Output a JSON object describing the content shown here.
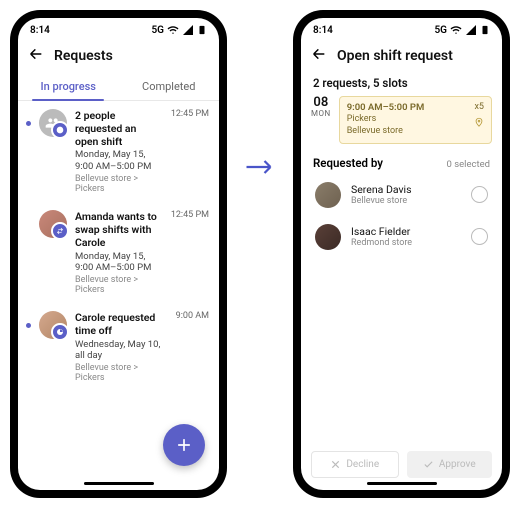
{
  "status": {
    "time": "8:14",
    "network": "5G"
  },
  "left": {
    "title": "Requests",
    "tabs": {
      "inprogress": "In progress",
      "completed": "Completed"
    },
    "items": [
      {
        "title": "2 people requested an open shift",
        "sub": "Monday, May 15, 9:00 AM–5:00 PM",
        "breadcrumb": "Bellevue store > Pickers",
        "time": "12:45 PM"
      },
      {
        "title": "Amanda wants to swap shifts with Carole",
        "sub": "Monday, May 15, 9:00 AM–5:00 PM",
        "breadcrumb": "Bellevue store > Pickers",
        "time": "12:45 PM"
      },
      {
        "title": "Carole requested time off",
        "sub": "Wednesday, May 10, all day",
        "breadcrumb": "Bellevue store > Pickers",
        "time": "9:00 AM"
      }
    ]
  },
  "right": {
    "title": "Open shift request",
    "summary": "2 requests, 5 slots",
    "date": {
      "num": "08",
      "day": "MON"
    },
    "slot": {
      "time": "9:00 AM–5:00 PM",
      "group": "Pickers",
      "store": "Bellevue store",
      "count": "x5"
    },
    "requested_by_label": "Requested by",
    "selected_label": "0 selected",
    "people": [
      {
        "name": "Serena Davis",
        "store": "Bellevue store"
      },
      {
        "name": "Isaac Fielder",
        "store": "Redmond store"
      }
    ],
    "buttons": {
      "decline": "Decline",
      "approve": "Approve"
    }
  }
}
